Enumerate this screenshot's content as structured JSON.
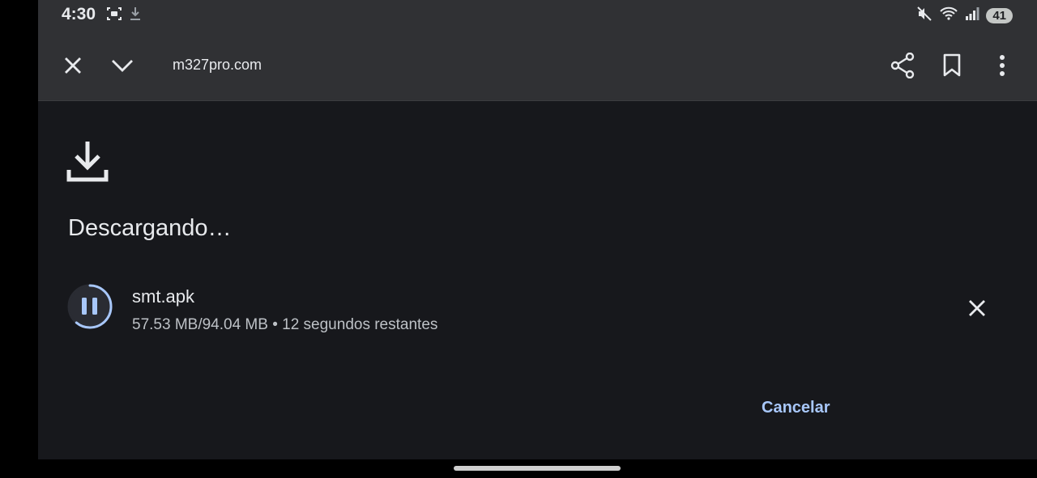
{
  "status_bar": {
    "time": "4:30",
    "battery": "41"
  },
  "toolbar": {
    "url": "m327pro.com"
  },
  "download": {
    "title": "Descargando…",
    "file_name": "smt.apk",
    "progress_text": "57.53 MB/94.04 MB • 12 segundos restantes",
    "progress_fraction": 0.61,
    "cancel_label": "Cancelar"
  },
  "colors": {
    "accent": "#a8c7fa",
    "background": "#17181c",
    "toolbar": "#303134"
  }
}
